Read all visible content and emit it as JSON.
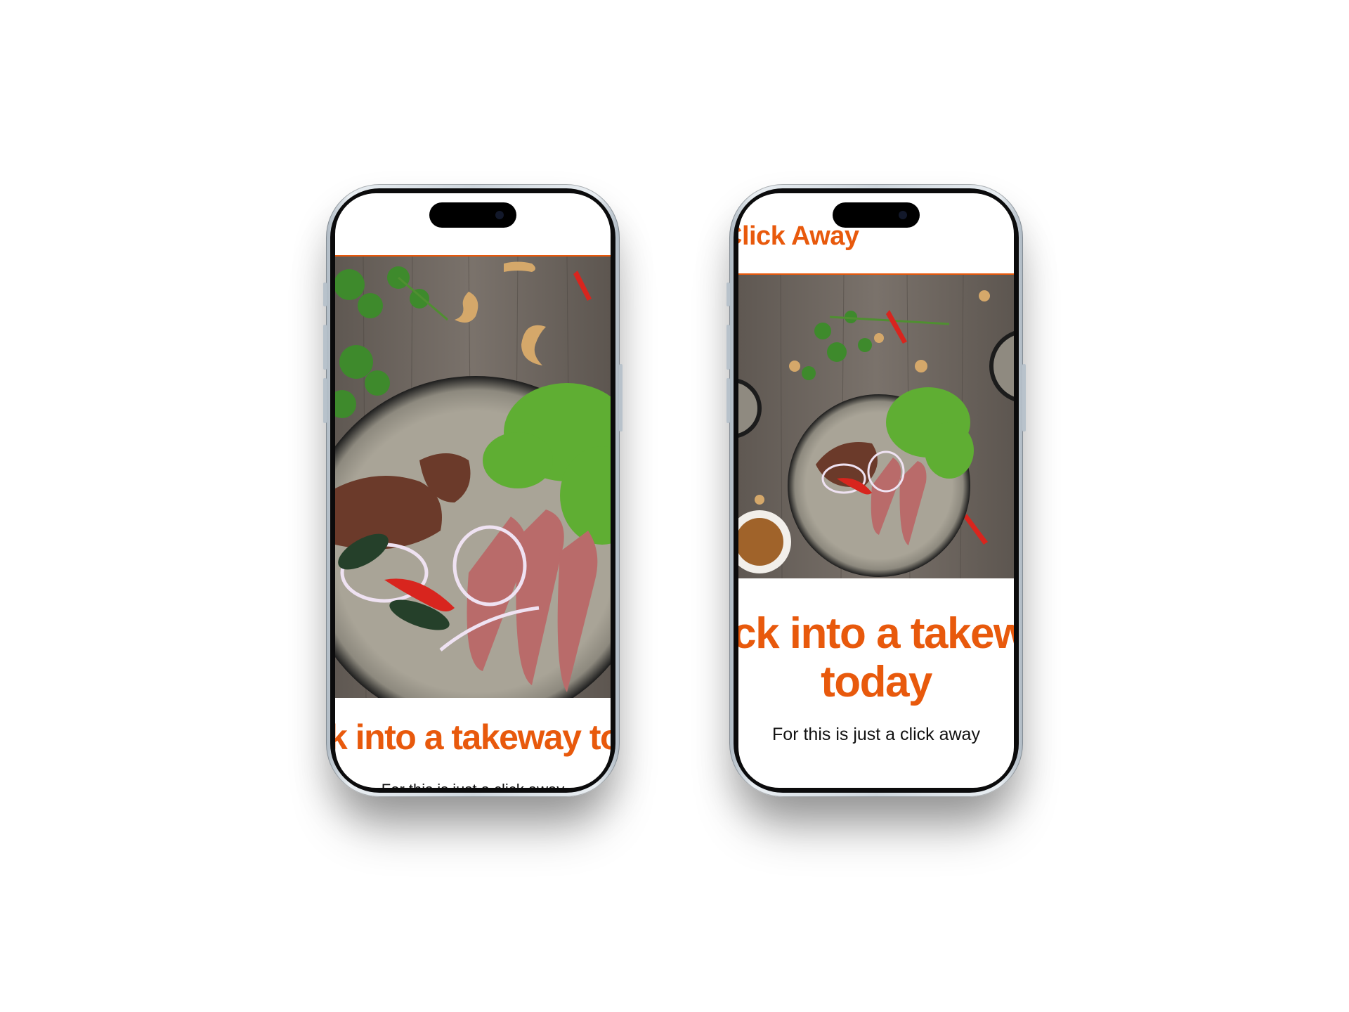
{
  "colors": {
    "accent": "#e8590c",
    "text": "#111111",
    "phone_frame": "#cfd7de",
    "bezel": "#0b0b0c"
  },
  "phone_small": {
    "headline": "Click into a takeway today",
    "tagline": "For this is just a click away",
    "image": "steak-salad-bowl-photo"
  },
  "phone_large": {
    "brand": "Click Away",
    "headline": "Click into a takeway today",
    "tagline": "For this is just a click away",
    "image": "steak-salad-bowl-photo"
  }
}
